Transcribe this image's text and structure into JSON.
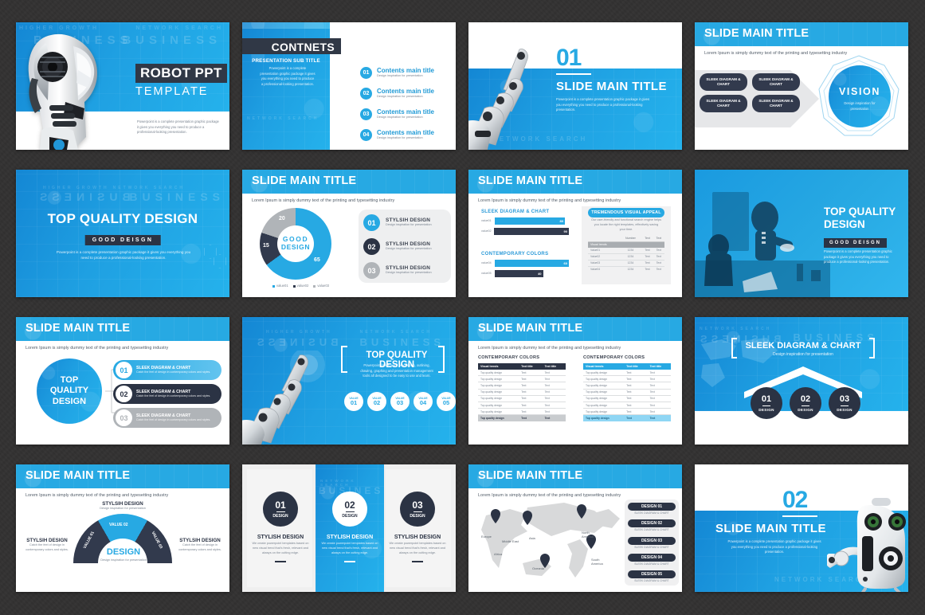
{
  "theme": {
    "accent_blue": "#27a9e3",
    "deep_blue": "#1487d4",
    "navy": "#323a4d",
    "gray": "#b0b4b8",
    "light_gray": "#f0f0f0",
    "background": "#333232"
  },
  "common": {
    "slide_main_title": "SLIDE MAIN TITLE",
    "lorem_sub": "Lorem Ipsum is simply dummy text of the printing and typesetting industry",
    "design_inspiration": "Design inspiration for presentation",
    "sleek_diagram_chart": "SLEEK DIAGRAM & CHART",
    "catch_feel": "Catch the feel of design in contemporary colors and styles.",
    "powerpoint_blurb": "Powerpoint is a complete presentation graphic package it gives you everything you need to produce a professional-looking presentation",
    "ghost_business": "BUSINESS",
    "ghost_network": "NETWORK SEARCH",
    "ghost_growth": "HIGHER GROWTH"
  },
  "slides": [
    {
      "id": "cover-robot",
      "title": "ROBOT PPT",
      "subtitle": "TEMPLATE",
      "body": "Powerpoint is a complete presentation graphic package it gives you everything you need to produce a professional-looking presentation."
    },
    {
      "id": "contents",
      "title": "CONTNETS",
      "subtitle": "PRESENTATION SUB TITLE",
      "body": "Powerpoint is a complete presentation graphic package it gives you everything you need to produce a professional-looking presentation.",
      "items": [
        {
          "num": "01",
          "title": "Contents main title",
          "desc": "Design inspiration for presentation"
        },
        {
          "num": "02",
          "title": "Contents main title",
          "desc": "Design inspiration for presentation"
        },
        {
          "num": "03",
          "title": "Contents main title",
          "desc": "Design inspiration for presentation"
        },
        {
          "num": "04",
          "title": "Contents main title",
          "desc": "Design inspiration for presentation"
        }
      ]
    },
    {
      "id": "section-01",
      "number": "01",
      "title": "SLIDE MAIN TITLE",
      "body": "Powerpoint is a complete presentation graphic package it gives you everything you need to produce a professional-looking presentation."
    },
    {
      "id": "vision",
      "title": "SLIDE MAIN TITLE",
      "subtitle": "Lorem Ipsum is simply dummy text of the printing and typesetting industry",
      "boxes": [
        "SLEEK DIAGRAM & CHART",
        "SLEEK DIAGRAM & CHART",
        "SLEEK DIAGRAM & CHART",
        "SLEEK DIAGRAM & CHART"
      ],
      "circle_title": "VISION",
      "circle_sub": "Design inspiration for presentation"
    },
    {
      "id": "top-quality-blue",
      "title": "TOP QUALITY DESIGN",
      "badge": "GOOD  DEISGN",
      "body": "Powerpoint is a complete presentation graphic package it gives you everything you need to produce a professional-looking presentation."
    },
    {
      "id": "donut-chart",
      "title": "SLIDE MAIN TITLE",
      "subtitle": "Lorem Ipsum is simply dummy text of the printing and typesetting industry",
      "center_top": "GOOD",
      "center_bottom": "DESIGN",
      "items": [
        {
          "num": "01",
          "title": "STYLSIH DESIGN",
          "desc": "Design inspiration for presentation"
        },
        {
          "num": "02",
          "title": "STYLSIH DESIGN",
          "desc": "Design inspiration for presentation"
        },
        {
          "num": "03",
          "title": "STYLSIH DESIGN",
          "desc": "Design inspiration for presentation"
        }
      ]
    },
    {
      "id": "bar-chart",
      "title": "SLIDE MAIN TITLE",
      "subtitle": "Lorem Ipsum is simply dummy text of the printing and typesetting industry",
      "group1_label": "SLEEK DIAGRAM & CHART",
      "group2_label": "CONTEMPORARY COLORS",
      "panel_title": "TREMENDOUS VISUAL APPEAL",
      "panel_body": "Our user-friendly and functional search engine helps you locate the right templates, effectively saving your time.",
      "table_headers": [
        "",
        "Number",
        "Text",
        "Text"
      ],
      "table_highlight": "Visual trends",
      "table_rows": [
        [
          "Value01",
          "1234",
          "Text",
          "Text"
        ],
        [
          "Value02",
          "1234",
          "Text",
          "Text"
        ],
        [
          "Value03",
          "1234",
          "Text",
          "Text"
        ],
        [
          "Value04",
          "1234",
          "Text",
          "Text"
        ]
      ]
    },
    {
      "id": "top-quality-photo",
      "title_line1": "TOP QUALITY",
      "title_line2": "DESIGN",
      "badge": "GOOD  DEISGN",
      "body": "Powerpoint is a complete presentation graphic package it gives you everything you need to produce a professional-looking presentation."
    },
    {
      "id": "circle-list",
      "title": "SLIDE MAIN TITLE",
      "subtitle": "Lorem Ipsum is simply dummy text of the printing and typesetting industry",
      "circle_lines": [
        "TOP",
        "QUALITY",
        "DESIGN"
      ],
      "items": [
        {
          "num": "01",
          "title": "SLEEK DIAGRAM & CHART",
          "desc": "Catch the feel of design in contemporary colors and styles."
        },
        {
          "num": "02",
          "title": "SLEEK DIAGRAM & CHART",
          "desc": "Catch the feel of design in contemporary colors and styles."
        },
        {
          "num": "03",
          "title": "SLEEK DIAGRAM & CHART",
          "desc": "Catch the feel of design in contemporary colors and styles."
        }
      ]
    },
    {
      "id": "hand-values",
      "title": "TOP QUALITY DESIGN",
      "body": "Powerpoint offers word processing, outlining, drawing, graphing and presentation management tools all designed to be easy to use and learn.",
      "values": [
        {
          "label": "VALUE",
          "num": "01"
        },
        {
          "label": "VALUE",
          "num": "02"
        },
        {
          "label": "VALUE",
          "num": "03"
        },
        {
          "label": "VALUE",
          "num": "04"
        },
        {
          "label": "VALUE",
          "num": "05"
        }
      ]
    },
    {
      "id": "tables",
      "title": "SLIDE MAIN TITLE",
      "subtitle": "Lorem Ipsum is simply dummy text of the printing and typesetting industry",
      "left_label": "CONTEMPORARY COLORS",
      "right_label": "CONTEMPORARY COLORS",
      "headers": [
        "Visual trends",
        "Text title",
        "Text title"
      ],
      "rows": [
        [
          "Top quality design",
          "Text",
          "Text"
        ],
        [
          "Top quality design",
          "Text",
          "Text"
        ],
        [
          "Top quality design",
          "Text",
          "Text"
        ],
        [
          "Top quality design",
          "Text",
          "Text"
        ],
        [
          "Top quality design",
          "Text",
          "Text"
        ],
        [
          "Top quality design",
          "Text",
          "Text"
        ],
        [
          "Top quality design",
          "Text",
          "Text"
        ],
        [
          "Top quality design",
          "Text",
          "Text"
        ]
      ],
      "footer_row": [
        "Top quality design",
        "Text",
        "Text"
      ]
    },
    {
      "id": "arrow-circles",
      "title": "SLEEK DIAGRAM & CHART",
      "subtitle": "Design inspiration for presentation",
      "circles": [
        {
          "num": "01",
          "label": "DESIGN"
        },
        {
          "num": "02",
          "label": "DESIGN"
        },
        {
          "num": "03",
          "label": "DESIGN"
        }
      ]
    },
    {
      "id": "semicircle",
      "title": "SLIDE MAIN TITLE",
      "subtitle": "Lorem Ipsum is simply dummy text of the printing and typesetting industry",
      "center_title": "DESIGN",
      "center_sub": "Design inspiration for presentation",
      "segments": [
        {
          "label": "VALUE 01"
        },
        {
          "label": "VALUE 02"
        },
        {
          "label": "VALUE 03"
        }
      ],
      "callouts": [
        {
          "title": "STYLSIH DESIGN",
          "desc": "Catch the feel of design in contemporary colors and styles."
        },
        {
          "title": "STYLSIH DESIGN",
          "desc": "Design inspiration for presentation"
        },
        {
          "title": "STYLSIH DESIGN",
          "desc": "Catch the feel of design in contemporary colors and styles."
        }
      ]
    },
    {
      "id": "three-columns",
      "columns": [
        {
          "num": "01",
          "label": "DESIGN",
          "title": "STYLISH DESIGN",
          "desc": "We create powerpoint templates based on new visual trend that's fresh, relevant and always on the cutting edge."
        },
        {
          "num": "02",
          "label": "DESIGN",
          "title": "STYLISH DESIGN",
          "desc": "We create powerpoint templates based on new visual trend that's fresh, relevant and always on the cutting edge."
        },
        {
          "num": "03",
          "label": "DESIGN",
          "title": "STYLISH DESIGN",
          "desc": "We create powerpoint templates based on new visual trend that's fresh, relevant and always on the cutting edge."
        }
      ]
    },
    {
      "id": "world-map",
      "title": "SLIDE MAIN TITLE",
      "subtitle": "Lorem Ipsum is simply dummy text of the printing and typesetting industry",
      "map_labels": [
        "Europe",
        "Middle East",
        "Asia",
        "Africa",
        "Oceania",
        "North America",
        "South America"
      ],
      "legend": [
        {
          "title": "DESIGN 01",
          "desc": "SLEEK DIAGRAM & CHART"
        },
        {
          "title": "DESIGN 02",
          "desc": "SLEEK DIAGRAM & CHART"
        },
        {
          "title": "DESIGN 03",
          "desc": "SLEEK DIAGRAM & CHART"
        },
        {
          "title": "DESIGN 04",
          "desc": "SLEEK DIAGRAM & CHART"
        },
        {
          "title": "DESIGN 05",
          "desc": "SLEEK DIAGRAM & CHART"
        }
      ]
    },
    {
      "id": "section-02",
      "number": "02",
      "title": "SLIDE MAIN TITLE",
      "body": "Powerpoint is a complete presentation graphic package it gives you everything you need to produce a professional-looking presentation."
    }
  ],
  "chart_data": [
    {
      "type": "pie",
      "title": "GOOD DESIGN",
      "slide": "donut-chart",
      "labels": [
        "value01",
        "value02",
        "value03"
      ],
      "values": [
        65,
        15,
        20
      ],
      "colors": [
        "#27a9e3",
        "#323a4d",
        "#b0b4b8"
      ],
      "legend": "bottom"
    },
    {
      "type": "bar",
      "slide": "bar-chart",
      "title": "SLEEK DIAGRAM & CHART",
      "orientation": "horizontal",
      "categories": [
        "value01",
        "value02"
      ],
      "values": [
        80,
        90
      ],
      "colors": [
        "#27a9e3",
        "#323a4d"
      ],
      "xlim": [
        0,
        100
      ]
    },
    {
      "type": "bar",
      "slide": "bar-chart",
      "title": "CONTEMPORARY COLORS",
      "orientation": "horizontal",
      "categories": [
        "value04",
        "value05"
      ],
      "values": [
        60,
        40
      ],
      "colors": [
        "#27a9e3",
        "#323a4d"
      ],
      "xlim": [
        0,
        100
      ]
    },
    {
      "type": "pie",
      "slide": "semicircle",
      "title": "DESIGN",
      "labels": [
        "VALUE 01",
        "VALUE 02",
        "VALUE 03"
      ],
      "values": [
        33,
        34,
        33
      ],
      "colors": [
        "#323a4d",
        "#27a9e3",
        "#323a4d"
      ],
      "legend": "none"
    }
  ]
}
